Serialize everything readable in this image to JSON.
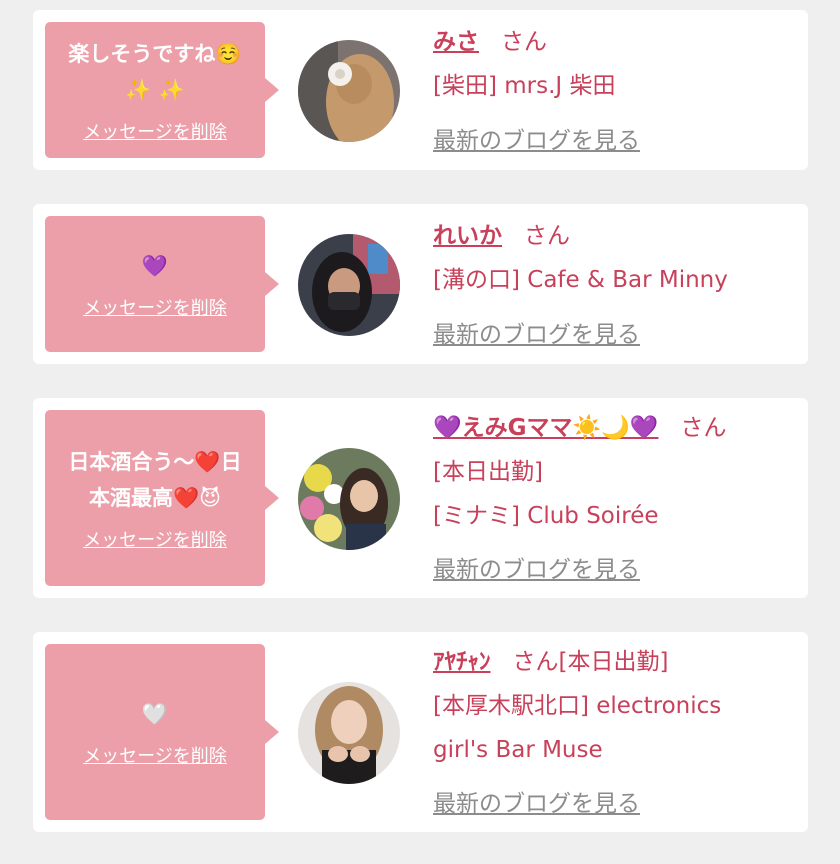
{
  "cards": [
    {
      "message": "楽しそうですね☺️",
      "message2": "✨ ✨",
      "delete_label": "メッセージを削除",
      "name": "みさ",
      "honorific": "さん",
      "lines": [
        "[柴田] mrs.J 柴田"
      ],
      "blog_label": "最新のブログを見る"
    },
    {
      "message": "💜",
      "delete_label": "メッセージを削除",
      "name": "れいか",
      "honorific": "さん",
      "lines": [
        "[溝の口] Cafe & Bar Minny"
      ],
      "blog_label": "最新のブログを見る"
    },
    {
      "message": "日本酒合う〜❤️日",
      "message2": "本酒最高❤️😈",
      "delete_label": "メッセージを削除",
      "name": "💜えみGママ☀️🌙💜",
      "honorific": "さん",
      "lines": [
        "[本日出勤]",
        "[ミナミ] Club Soirée"
      ],
      "blog_label": "最新のブログを見る"
    },
    {
      "message": "🤍",
      "delete_label": "メッセージを削除",
      "name": "ｱﾔﾁｬﾝ",
      "honorific": "さん[本日出勤]",
      "lines": [
        "[本厚木駅北口] electronics",
        "girl's Bar Muse"
      ],
      "blog_label": "最新のブログを見る"
    }
  ]
}
